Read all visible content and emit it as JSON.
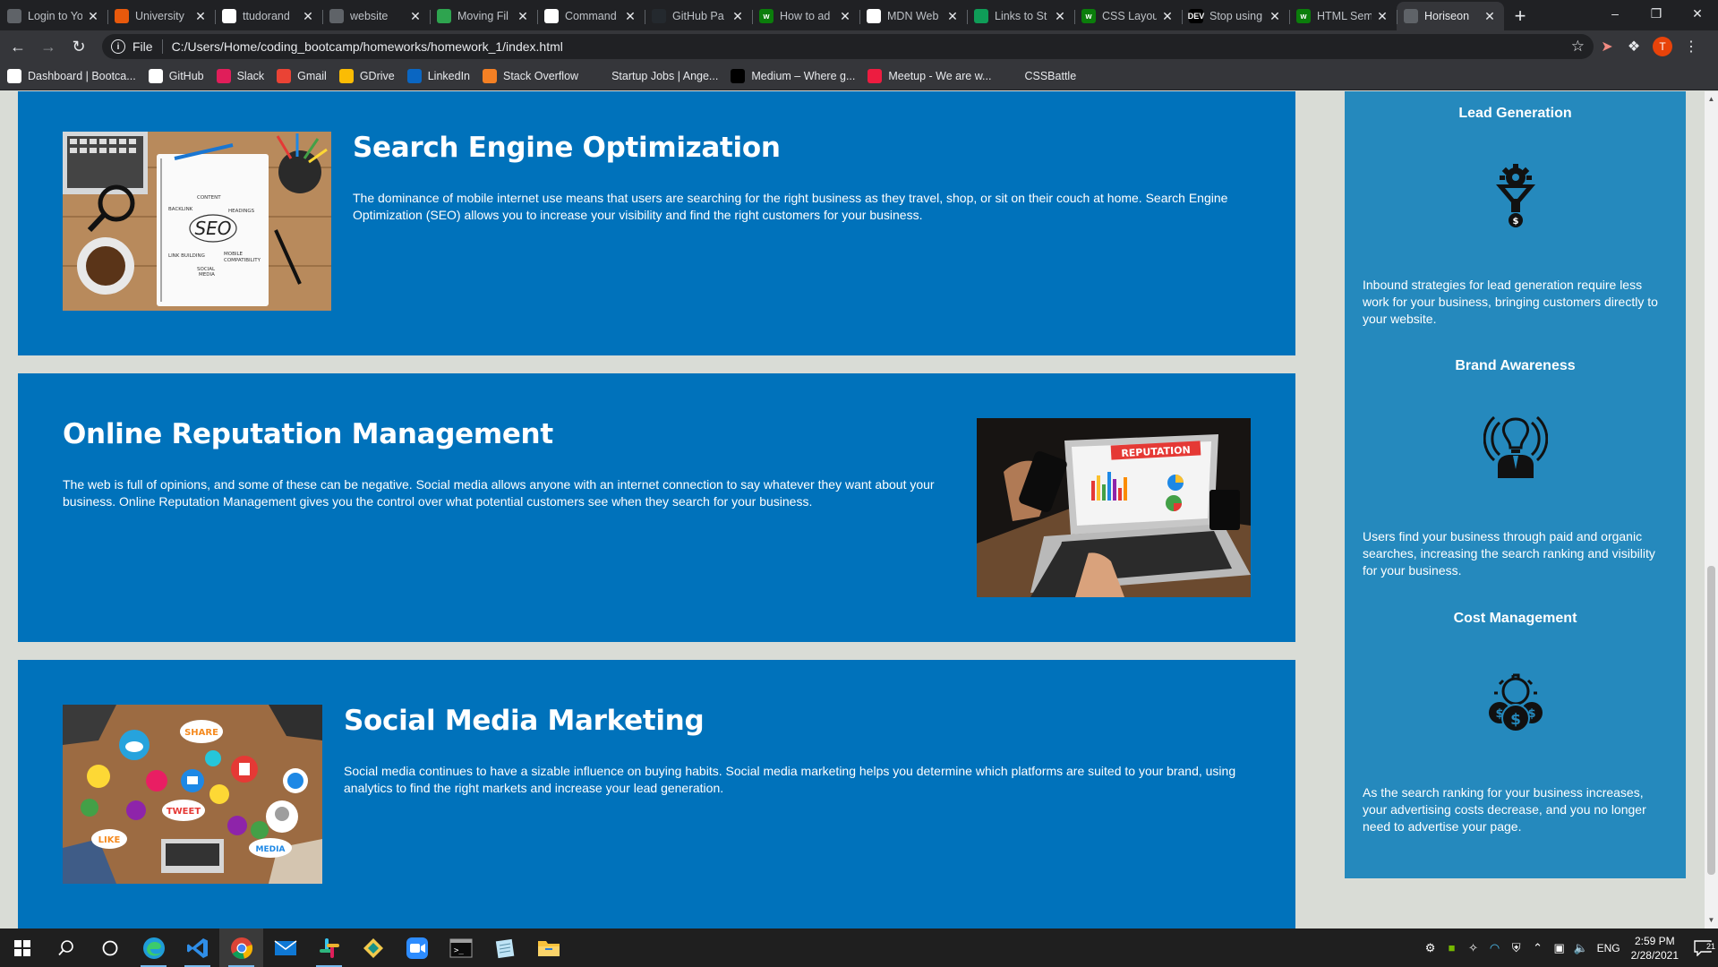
{
  "browser": {
    "tabs": [
      {
        "title": "Login to Yo",
        "fav_bg": "#5f6368",
        "fav_text": "",
        "active": false
      },
      {
        "title": "University",
        "fav_bg": "#e8590c",
        "fav_text": "",
        "active": false
      },
      {
        "title": "ttudorand",
        "fav_bg": "#ffffff",
        "fav_text": "",
        "active": false
      },
      {
        "title": "website",
        "fav_bg": "#5f6368",
        "fav_text": "",
        "active": false
      },
      {
        "title": "Moving Fil",
        "fav_bg": "#2ea44f",
        "fav_text": "",
        "active": false
      },
      {
        "title": "Command",
        "fav_bg": "#ffffff",
        "fav_text": "",
        "active": false
      },
      {
        "title": "GitHub Pa",
        "fav_bg": "#24292e",
        "fav_text": "",
        "active": false
      },
      {
        "title": "How to ad",
        "fav_bg": "#0b7d0b",
        "fav_text": "w",
        "active": false
      },
      {
        "title": "MDN Web",
        "fav_bg": "#ffffff",
        "fav_text": "",
        "active": false
      },
      {
        "title": "Links to St",
        "fav_bg": "#0f9d58",
        "fav_text": "",
        "active": false
      },
      {
        "title": "CSS Layou",
        "fav_bg": "#0b7d0b",
        "fav_text": "w",
        "active": false
      },
      {
        "title": "Stop using",
        "fav_bg": "#000000",
        "fav_text": "DEV",
        "active": false
      },
      {
        "title": "HTML Sem",
        "fav_bg": "#0b7d0b",
        "fav_text": "w",
        "active": false
      },
      {
        "title": "Horiseon",
        "fav_bg": "#5f6368",
        "fav_text": "",
        "active": true
      }
    ],
    "scheme_label": "File",
    "url": "C:/Users/Home/coding_bootcamp/homeworks/homework_1/index.html",
    "avatar_letter": "T",
    "bookmarks": [
      {
        "label": "Dashboard | Bootca...",
        "fav_bg": "#ffffff"
      },
      {
        "label": "GitHub",
        "fav_bg": "#ffffff"
      },
      {
        "label": "Slack",
        "fav_bg": "#e01e5a"
      },
      {
        "label": "Gmail",
        "fav_bg": "#ea4335"
      },
      {
        "label": "GDrive",
        "fav_bg": "#fbbc04"
      },
      {
        "label": "LinkedIn",
        "fav_bg": "#0a66c2"
      },
      {
        "label": "Stack Overflow",
        "fav_bg": "#f48024"
      },
      {
        "label": "Startup Jobs | Ange...",
        "fav_bg": "#35363a"
      },
      {
        "label": "Medium – Where g...",
        "fav_bg": "#000000"
      },
      {
        "label": "Meetup - We are w...",
        "fav_bg": "#ed1c40"
      },
      {
        "label": "CSSBattle",
        "fav_bg": "#35363a"
      }
    ]
  },
  "page": {
    "colors": {
      "card": "#0072bb",
      "aside": "#2589bd",
      "background": "#d9dcd6"
    },
    "cards": [
      {
        "title": "Search Engine Optimization",
        "text": "The dominance of mobile internet use means that users are searching for the right business as they travel, shop, or sit on their couch at home. Search Engine Optimization (SEO) allows you to increase your visibility and find the right customers for your business.",
        "image": "seo-notebook-photo"
      },
      {
        "title": "Online Reputation Management",
        "text": "The web is full of opinions, and some of these can be negative. Social media allows anyone with an internet connection to say whatever they want about your business. Online Reputation Management gives you the control over what potential customers see when they search for your business.",
        "image": "reputation-laptop-photo",
        "image_label": "REPUTATION"
      },
      {
        "title": "Social Media Marketing",
        "text": "Social media continues to have a sizable influence on buying habits. Social media marketing helps you determine which platforms are suited to your brand, using analytics to find the right markets and increase your lead generation.",
        "image": "social-media-table-photo"
      }
    ],
    "benefits": [
      {
        "title": "Lead Generation",
        "icon": "funnel-gear-icon",
        "text": "Inbound strategies for lead generation require less work for your business, bringing customers directly to your website."
      },
      {
        "title": "Brand Awareness",
        "icon": "lightbulb-person-icon",
        "text": "Users find your business through paid and organic searches, increasing the search ranking and visibility for your business."
      },
      {
        "title": "Cost Management",
        "icon": "gear-coins-icon",
        "text": "As the search ranking for your business increases, your advertising costs decrease, and you no longer need to advertise your page."
      }
    ]
  },
  "taskbar": {
    "apps": [
      "windows-start-icon",
      "search-icon",
      "cortana-icon",
      "edge-icon",
      "vscode-icon",
      "chrome-icon",
      "mail-icon",
      "slack-icon",
      "gitkraken-icon",
      "zoom-icon",
      "terminal-icon",
      "notepad-icon",
      "file-explorer-icon"
    ],
    "language": "ENG",
    "time": "2:59 PM",
    "date": "2/28/2021",
    "notification_count": "21"
  }
}
